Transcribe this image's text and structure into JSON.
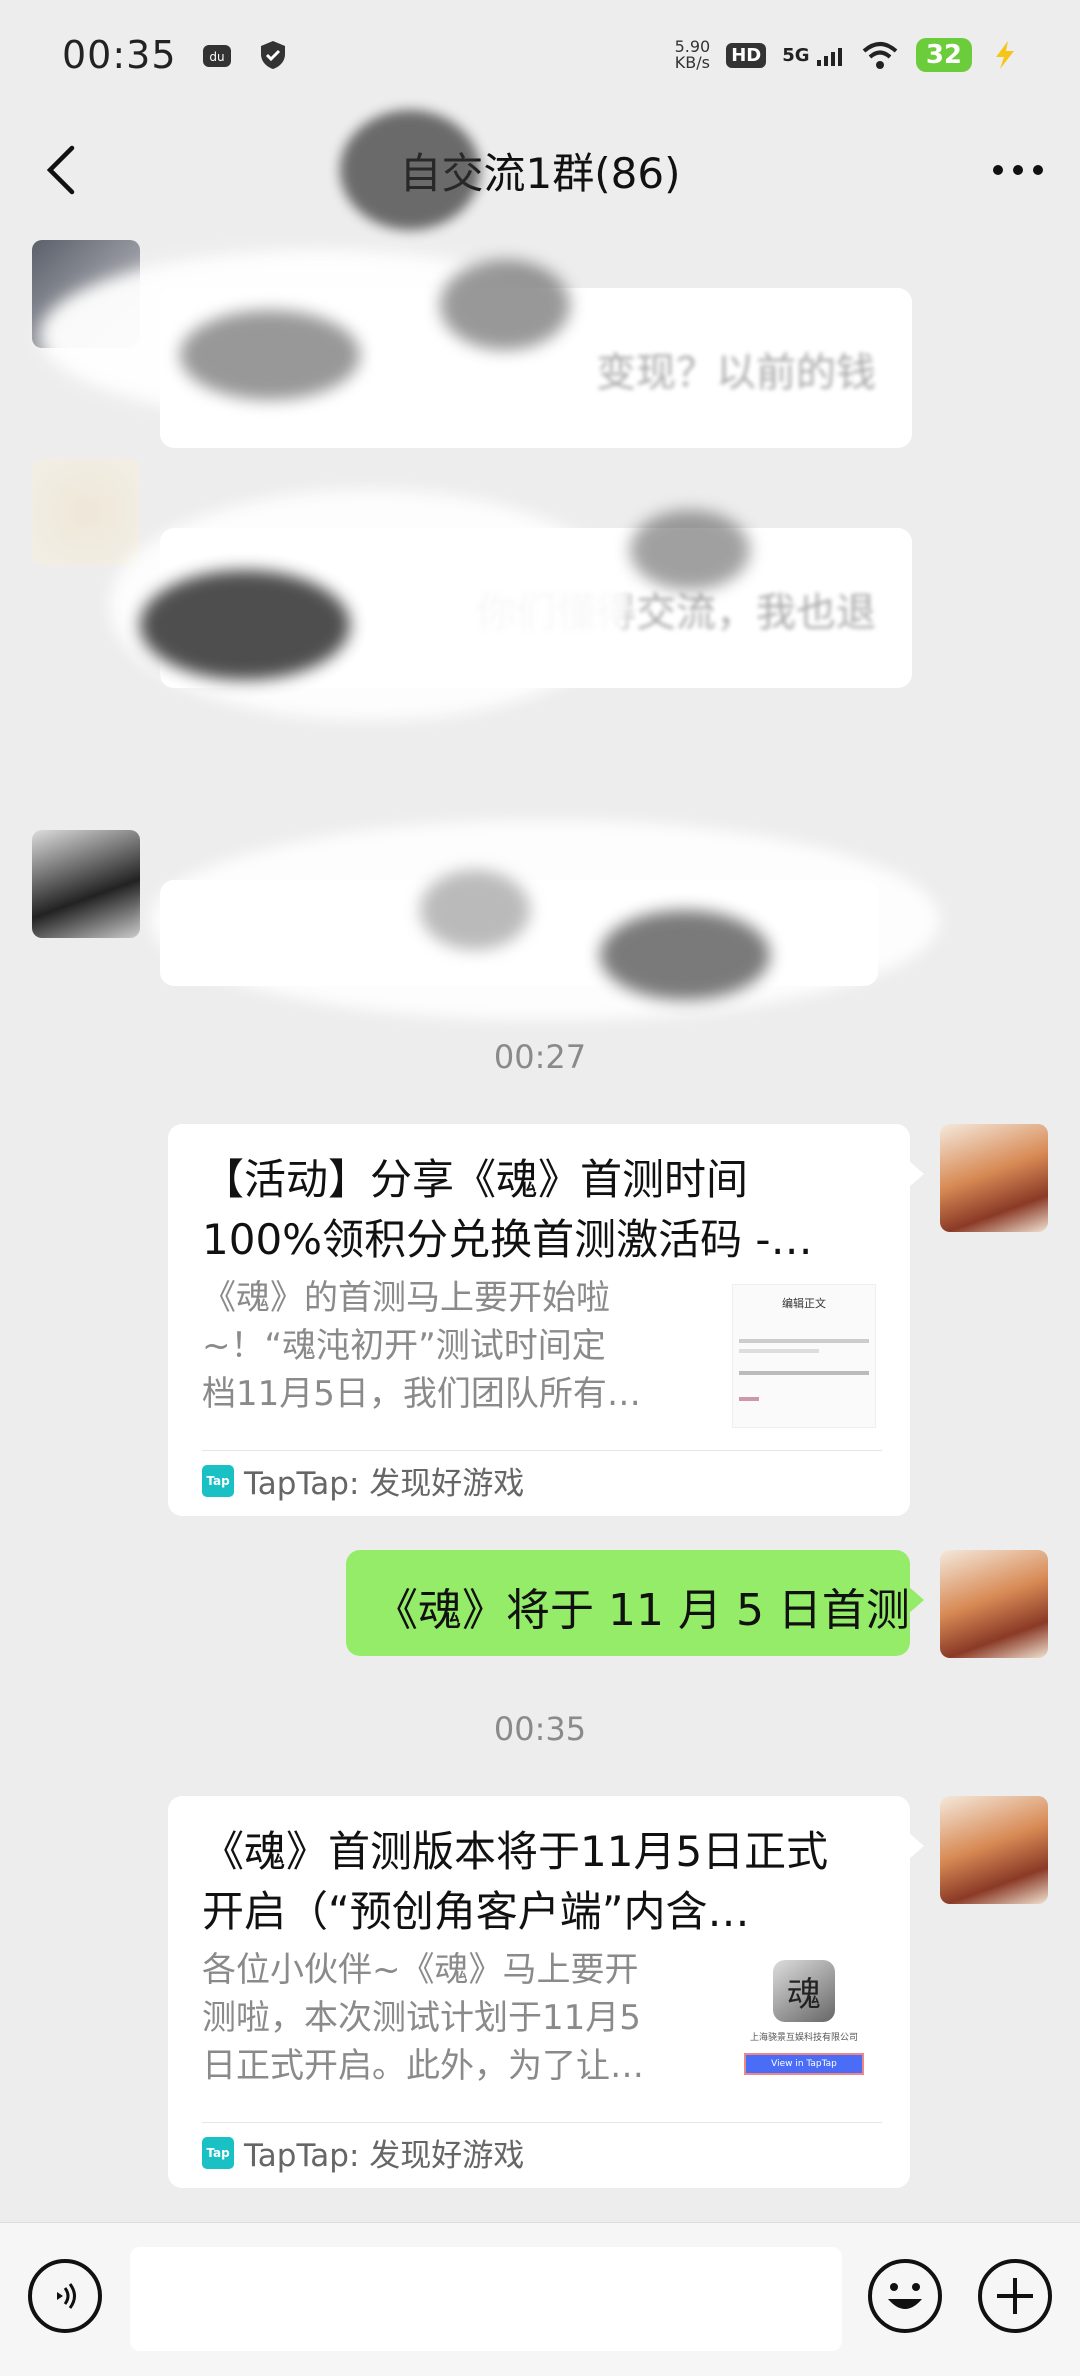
{
  "status_bar": {
    "time": "00:35",
    "net_speed_value": "5.90",
    "net_speed_unit": "KB/s",
    "hd": "HD",
    "network": "5G",
    "battery": "32"
  },
  "nav": {
    "title": "自交流1群(86)"
  },
  "messages": {
    "blurred_1_text": "变现？以前的钱",
    "blurred_2_text": "你们懂得交流，我也退",
    "timestamp_1": "00:27",
    "card_1": {
      "title_line1": "【活动】分享《魂》首测时间",
      "title_line2": "100%领积分兑换首测激活码 -…",
      "desc_line1": "《魂》的首测马上要开始啦",
      "desc_line2": "~！“魂沌初开”测试时间定",
      "desc_line3": "档11月5日，我们团队所有…",
      "source": "TapTap: 发现好游戏",
      "thumb_text": "编辑正文"
    },
    "green_text": "《魂》将于 11 月 5 日首测",
    "timestamp_2": "00:35",
    "card_2": {
      "title_line1": "《魂》首测版本将于11月5日正式",
      "title_line2": "开启（“预创角客户端”内含…",
      "desc_line1": "各位小伙伴~《魂》马上要开",
      "desc_line2": "测啦，本次测试计划于11月5",
      "desc_line3": "日正式开启。此外，为了让…",
      "source": "TapTap: 发现好游戏",
      "thumb_caption": "上海骁景互娱科技有限公司",
      "thumb_button": "View in TapTap"
    }
  },
  "input_bar": {
    "placeholder": ""
  }
}
